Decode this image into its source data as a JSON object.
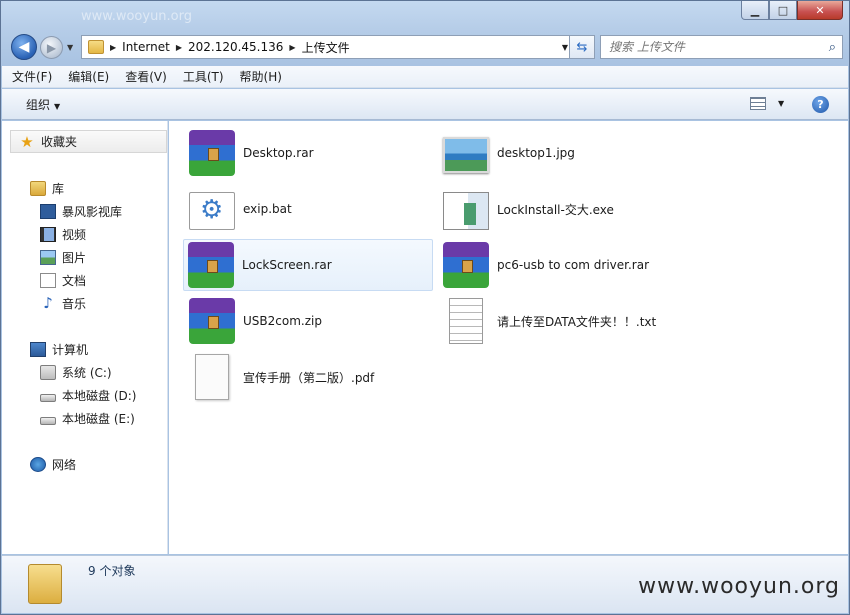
{
  "window": {
    "watermark_top": "www.wooyun.org",
    "caption": {
      "min": "▁",
      "max": "□",
      "close": "✕"
    }
  },
  "nav": {
    "back_glyph": "◀",
    "forward_glyph": "▶",
    "breadcrumb": [
      "Internet",
      "202.120.45.136",
      "上传文件"
    ],
    "search_placeholder": "搜索 上传文件"
  },
  "menu": [
    "文件(F)",
    "编辑(E)",
    "查看(V)",
    "工具(T)",
    "帮助(H)"
  ],
  "command_bar": {
    "organize": "组织"
  },
  "sidebar": {
    "favorites": "收藏夹",
    "libraries": "库",
    "library_items": [
      "暴风影视库",
      "视频",
      "图片",
      "文档",
      "音乐"
    ],
    "computer": "计算机",
    "drives": [
      "系统 (C:)",
      "本地磁盘 (D:)",
      "本地磁盘 (E:)"
    ],
    "network": "网络"
  },
  "files": [
    {
      "name": "Desktop.rar",
      "icon": "winrar-archive-icon"
    },
    {
      "name": "desktop1.jpg",
      "icon": "image-file-icon"
    },
    {
      "name": "exip.bat",
      "icon": "batch-file-icon"
    },
    {
      "name": "LockInstall-交大.exe",
      "icon": "executable-icon"
    },
    {
      "name": "LockScreen.rar",
      "icon": "winrar-archive-icon",
      "selected": true
    },
    {
      "name": "pc6-usb to com driver.rar",
      "icon": "winrar-archive-icon"
    },
    {
      "name": "USB2com.zip",
      "icon": "winrar-archive-icon"
    },
    {
      "name": "请上传至DATA文件夹！！.txt",
      "icon": "text-file-icon"
    },
    {
      "name": "宣传手册（第二版）.pdf",
      "icon": "blank-file-icon"
    }
  ],
  "status": {
    "count": "9 个对象",
    "watermark": "www.wooyun.org"
  }
}
